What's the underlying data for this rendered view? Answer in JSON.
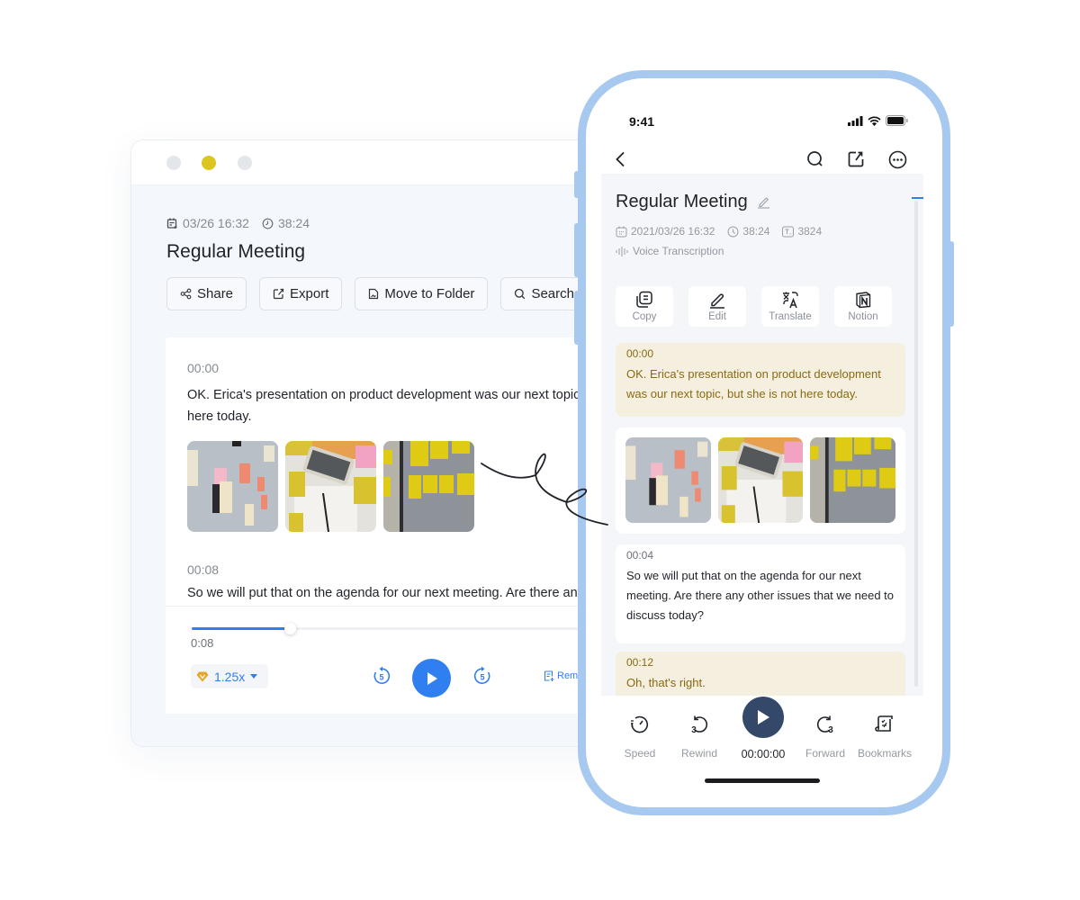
{
  "desktop": {
    "window_controls": [
      "close",
      "minimize",
      "maximize"
    ],
    "meta": {
      "date": "03/26 16:32",
      "duration": "38:24"
    },
    "title": "Regular Meeting",
    "actions": [
      {
        "label": "Share",
        "icon": "share-icon"
      },
      {
        "label": "Export",
        "icon": "export-icon"
      },
      {
        "label": "Move to Folder",
        "icon": "folder-icon"
      },
      {
        "label": "Search",
        "icon": "search-icon"
      }
    ],
    "segments": [
      {
        "time": "00:00",
        "text": "OK. Erica's presentation on product development was our next topic, but she is not here today."
      },
      {
        "time": "00:08",
        "text": "So we will put that on the agenda for our next meeting. Are there any other issues that we need to discuss today?"
      }
    ],
    "images": [
      "sticky-notes-wall",
      "phone-and-notes",
      "yellow-sticky-notes"
    ],
    "player": {
      "current_time": "0:08",
      "progress_percent": 21,
      "speed": "1.25x",
      "skip_back_seconds": "5",
      "skip_forward_seconds": "5",
      "remark_label": "Rema"
    }
  },
  "phone": {
    "status": {
      "time": "9:41"
    },
    "title": "Regular Meeting",
    "meta": {
      "datetime": "2021/03/26 16:32",
      "duration": "38:24",
      "word_count": "3824",
      "type": "Voice Transcription"
    },
    "actions": [
      {
        "label": "Copy",
        "icon": "copy-icon"
      },
      {
        "label": "Edit",
        "icon": "edit-icon"
      },
      {
        "label": "Translate",
        "icon": "translate-icon"
      },
      {
        "label": "Notion",
        "icon": "notion-icon"
      }
    ],
    "segments": [
      {
        "time": "00:00",
        "text": "OK. Erica's presentation on product development was our next topic, but she is not here today.",
        "highlighted": true
      },
      {
        "time": "00:04",
        "text": "So we will put that on the agenda for our next meeting. Are there any other issues that we need to discuss today?",
        "highlighted": false
      },
      {
        "time": "00:12",
        "text": "Oh, that's right.",
        "highlighted": true
      }
    ],
    "images": [
      "sticky-notes-wall",
      "phone-and-notes",
      "yellow-sticky-notes"
    ],
    "bottom_bar": {
      "speed_label": "Speed",
      "rewind_label": "Rewind",
      "rewind_seconds": "3",
      "play_time": "00:00:00",
      "forward_label": "Forward",
      "forward_seconds": "3",
      "bookmarks_label": "Bookmarks"
    }
  },
  "colors": {
    "accent": "#2f7ff0",
    "phone_frame": "#a7c9f0",
    "highlight_bg": "#f4efdf",
    "highlight_text": "#8a6a12",
    "play_dark": "#34496a",
    "premium_gold": "#e3a82b",
    "traffic_yellow": "#dcc51f"
  }
}
